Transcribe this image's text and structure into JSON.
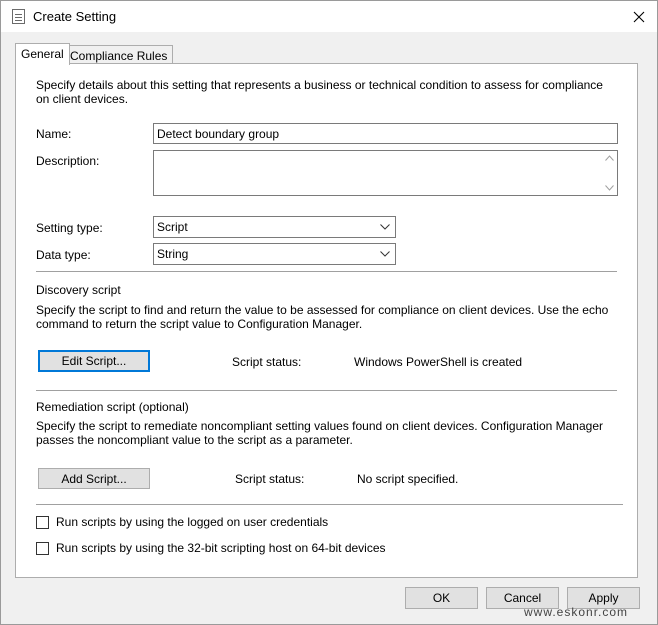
{
  "window": {
    "title": "Create Setting",
    "icon": "document-icon",
    "close_icon": "close-icon"
  },
  "tabs": [
    {
      "label": "General",
      "active": true
    },
    {
      "label": "Compliance Rules",
      "active": false
    }
  ],
  "general": {
    "intro": "Specify details about this setting that represents a business or technical condition to assess for compliance on client devices.",
    "name_label": "Name:",
    "name_value": "Detect boundary group",
    "description_label": "Description:",
    "description_value": "",
    "setting_type_label": "Setting type:",
    "setting_type_value": "Script",
    "data_type_label": "Data type:",
    "data_type_value": "String"
  },
  "discovery": {
    "heading": "Discovery script",
    "description": "Specify the script to find and return the value to be assessed for compliance on client devices. Use the echo command to return the script value to Configuration Manager.",
    "button_label": "Edit Script...",
    "status_label": "Script status:",
    "status_value": "Windows PowerShell is created"
  },
  "remediation": {
    "heading": "Remediation script (optional)",
    "description": "Specify the script to remediate noncompliant setting values found on client devices. Configuration Manager passes the noncompliant value to the script as a parameter.",
    "button_label": "Add Script...",
    "status_label": "Script status:",
    "status_value": "No script specified."
  },
  "options": {
    "run_logged_on": {
      "label": "Run scripts by using the logged on user credentials",
      "checked": false
    },
    "run_32bit": {
      "label": "Run scripts by using the 32-bit scripting host on 64-bit devices",
      "checked": false
    }
  },
  "footer": {
    "ok_label": "OK",
    "cancel_label": "Cancel",
    "apply_label": "Apply"
  },
  "watermark": "www.eskonr.com",
  "colors": {
    "focus_border": "#0078d7",
    "button_bg": "#e1e1e1",
    "dialog_bg": "#f0f0f0"
  }
}
